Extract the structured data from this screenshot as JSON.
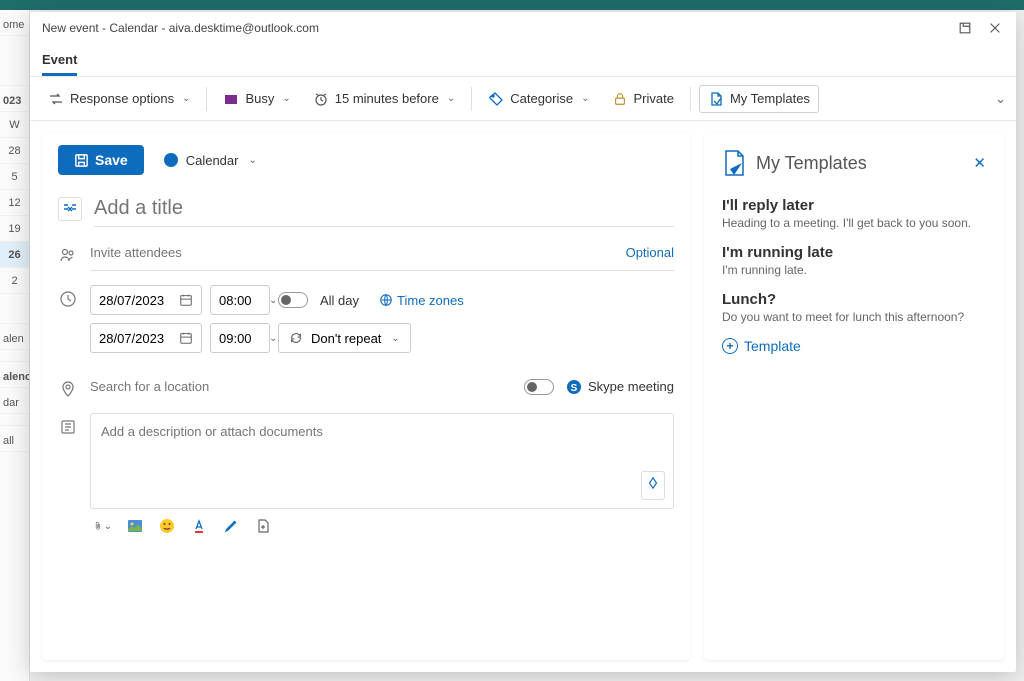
{
  "dialog_title": "New event - Calendar - aiva.desktime@outlook.com",
  "tab_label": "Event",
  "toolbar": {
    "response_options": "Response options",
    "busy": "Busy",
    "reminder": "15 minutes before",
    "categorise": "Categorise",
    "private": "Private",
    "my_templates": "My Templates"
  },
  "form": {
    "save": "Save",
    "calendar_name": "Calendar",
    "title_placeholder": "Add a title",
    "attendees_placeholder": "Invite attendees",
    "optional": "Optional",
    "start_date": "28/07/2023",
    "start_time": "08:00",
    "end_date": "28/07/2023",
    "end_time": "09:00",
    "all_day": "All day",
    "time_zones": "Time zones",
    "repeat": "Don't repeat",
    "location_placeholder": "Search for a location",
    "skype_meeting": "Skype meeting",
    "description_placeholder": "Add a description or attach documents"
  },
  "templates_panel": {
    "title": "My Templates",
    "items": [
      {
        "title": "I'll reply later",
        "body": "Heading to a meeting. I'll get back to you soon."
      },
      {
        "title": "I'm running late",
        "body": "I'm running late."
      },
      {
        "title": "Lunch?",
        "body": "Do you want to meet for lunch this afternoon?"
      }
    ],
    "add_label": "Template"
  },
  "bg": {
    "home": "ome",
    "year": "023",
    "w": "W",
    "d28": "28",
    "d5": "5",
    "d12": "12",
    "d19": "19",
    "d26": "26",
    "d2": "2",
    "calen": "alen",
    "calenc": "alenc",
    "dar": "dar",
    "all": "all"
  }
}
